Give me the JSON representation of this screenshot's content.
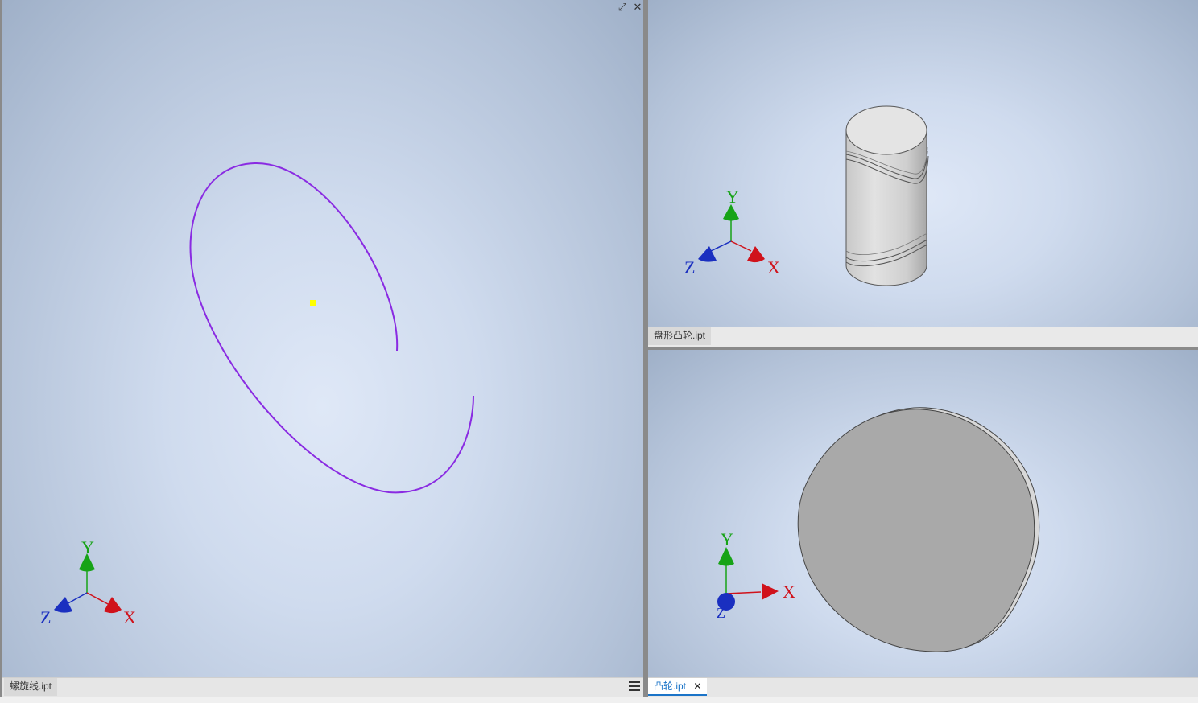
{
  "viewports": {
    "left": {
      "document_tab": "螺旋线.ipt",
      "active": false,
      "model": "helix-curve",
      "curve_color": "#8a2be2",
      "center_point_color": "#ffff00"
    },
    "top_right": {
      "document_tab": "盘形凸轮.ipt",
      "active": false,
      "model": "cylindrical-cam"
    },
    "bottom_right": {
      "document_tab": "凸轮.ipt",
      "active": true,
      "close_symbol": "✕",
      "model": "disc-cam"
    }
  },
  "triad": {
    "x_label": "X",
    "y_label": "Y",
    "z_label": "Z",
    "x_color": "#d0121b",
    "y_color": "#17a317",
    "z_color": "#1a2fc0"
  },
  "viewport_controls": {
    "maximize_icon": "⤢",
    "close_icon": "✕"
  },
  "colors": {
    "accent": "#1b74c8",
    "cam_face": "#a9a9a9",
    "cylinder_body": "#d4d4d4"
  }
}
